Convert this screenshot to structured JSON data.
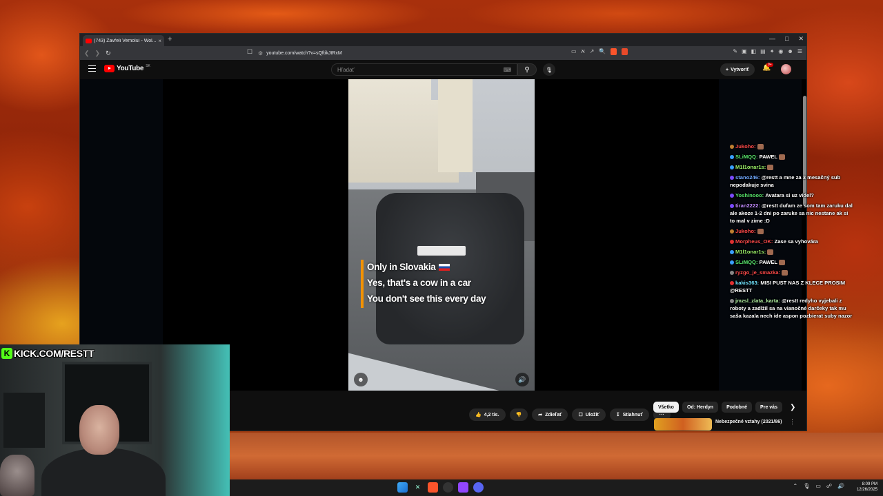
{
  "colors": {
    "accent": "#ff0000",
    "kick_green": "#53fc18",
    "overlay_orange": "#f39200"
  },
  "browser": {
    "tab_title": "(743) Zavřeli Vemoluí - Wol...",
    "url": "youtube.com/watch?v=sQftikJtRxM",
    "tab_close": "×",
    "new_tab": "+"
  },
  "youtube": {
    "logo_text": "YouTube",
    "country_code": "SK",
    "search_placeholder": "Hľadať",
    "create_label": "Vytvoriť",
    "notification_count": "9+"
  },
  "video": {
    "caption_lines": [
      "Only in Slovakia",
      "Yes, that's a cow in a car",
      "You don't see this every day"
    ]
  },
  "actions": {
    "like_count": "4,2 tis.",
    "share_label": "Zdieľať",
    "save_label": "Uložiť",
    "download_label": "Stiahnuť",
    "more": "···"
  },
  "chips": [
    "Všetko",
    "Od: Herdyn",
    "Podobné",
    "Pre vás"
  ],
  "recommendation": {
    "title": "Nebezpečné vztahy (2021/86)"
  },
  "chat": [
    {
      "user": "Jukoho:",
      "color": "#ff4a4a",
      "badge": "#c08030",
      "text": "",
      "emote": true
    },
    {
      "user": "SLiMQQ:",
      "color": "#57e36b",
      "badge": "#3aa0ff",
      "text": "PAWEL",
      "emote": true
    },
    {
      "user": "M1l1onar1s:",
      "color": "#9ef46a",
      "badge": "#3aa0ff",
      "text": "",
      "emote": true
    },
    {
      "user": "stano246:",
      "color": "#6fa8ff",
      "badge": "#7a4aff",
      "text": "@restt a mne za 3 mesačný sub nepodakuje svina",
      "emote": false
    },
    {
      "user": "Yoshinooo:",
      "color": "#57e36b",
      "badge": "#7a4aff",
      "text": "Avatara si uz videl?",
      "emote": false
    },
    {
      "user": "tiran2222:",
      "color": "#c08cff",
      "badge": "#7a4aff",
      "text": "@restt dufam ze som tam zaruku dal ale akoze 1-2 dni po zaruke sa nic nestane ak si to mal v zime :D",
      "emote": false
    },
    {
      "user": "Jukoho:",
      "color": "#ff4a4a",
      "badge": "#c08030",
      "text": "",
      "emote": true
    },
    {
      "user": "Morpheus_OK:",
      "color": "#ff4a4a",
      "badge": "#e03030",
      "text": "Zase sa vyhovára",
      "emote": false
    },
    {
      "user": "M1l1onar1s:",
      "color": "#9ef46a",
      "badge": "#3aa0ff",
      "text": "",
      "emote": true
    },
    {
      "user": "SLiMQQ:",
      "color": "#57e36b",
      "badge": "#3aa0ff",
      "text": "PAWEL",
      "emote": true
    },
    {
      "user": "ryzgo_je_smazka:",
      "color": "#ff4a4a",
      "badge": "#888888",
      "text": "",
      "emote": true
    },
    {
      "user": "kakis363:",
      "color": "#6fe3ff",
      "badge": "#e03030",
      "text": "MISI PUST NAS Z KLECE PROSIM @RESTT",
      "emote": false
    },
    {
      "user": "jmzsl_zlata_karta:",
      "color": "#b0f0a0",
      "badge": "#888888",
      "text": "@restt redyho vyjebali z roboty a zadlžil sa na vianočné darčeky tak mu saša kazala nech ide aspon pozbierat suby nazor",
      "emote": false
    }
  ],
  "webcam": {
    "kick_text": "KICK.COM/RESTT",
    "kick_logo": "K"
  },
  "taskbar": {
    "time": "8:09 PM",
    "date": "12/26/2025"
  }
}
